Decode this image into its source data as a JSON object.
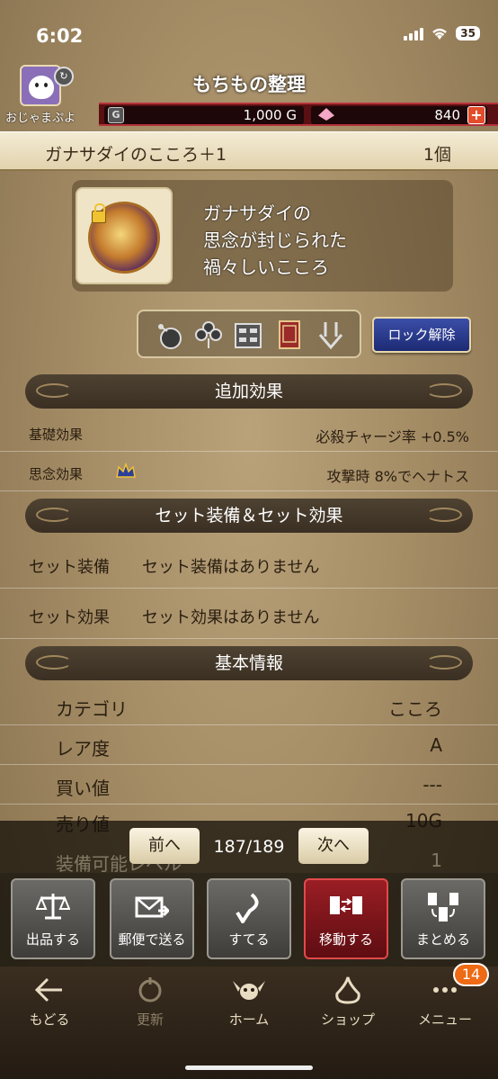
{
  "status_bar": {
    "time": "6:02",
    "battery": "35"
  },
  "header": {
    "title": "もちもの整理",
    "username": "おじゃまぷよ",
    "gold": "1,000 G",
    "gold_icon": "G",
    "gems": "840",
    "plus": "+"
  },
  "item": {
    "name": "ガナサダイのこころ＋1",
    "count": "1個",
    "description": "ガナサダイの\n思念が封じられた\n禍々しいこころ",
    "unlock_label": "ロック解除"
  },
  "icons": [
    "bag-icon",
    "clover-icon",
    "storage-icon",
    "book-icon",
    "arrow-down-icon"
  ],
  "added_effects": {
    "title": "追加効果",
    "rows": [
      {
        "label": "基礎効果",
        "value": "必殺チャージ率 +0.5%"
      },
      {
        "label": "思念効果",
        "value": "攻撃時 8%でヘナトス"
      }
    ]
  },
  "set_effects": {
    "title": "セット装備＆セット効果",
    "rows": [
      {
        "label": "セット装備",
        "value": "セット装備はありません"
      },
      {
        "label": "セット効果",
        "value": "セット効果はありません"
      }
    ]
  },
  "basic_info": {
    "title": "基本情報",
    "rows": [
      {
        "label": "カテゴリ",
        "value": "こころ"
      },
      {
        "label": "レア度",
        "value": "A"
      },
      {
        "label": "買い値",
        "value": "---"
      },
      {
        "label": "売り値",
        "value": "10G"
      },
      {
        "label": "装備可能レベル",
        "value": "1"
      }
    ]
  },
  "pager": {
    "prev": "前へ",
    "position": "187/189",
    "next": "次へ"
  },
  "actions": [
    "出品する",
    "郵便で送る",
    "すてる",
    "移動する",
    "まとめる"
  ],
  "tabs": [
    "もどる",
    "更新",
    "ホーム",
    "ショップ",
    "メニュー"
  ],
  "menu_badge": "14",
  "colors": {
    "accent_red": "#9a1e24",
    "unlock_blue": "#2a3a8c",
    "badge_orange": "#ee6a14"
  }
}
